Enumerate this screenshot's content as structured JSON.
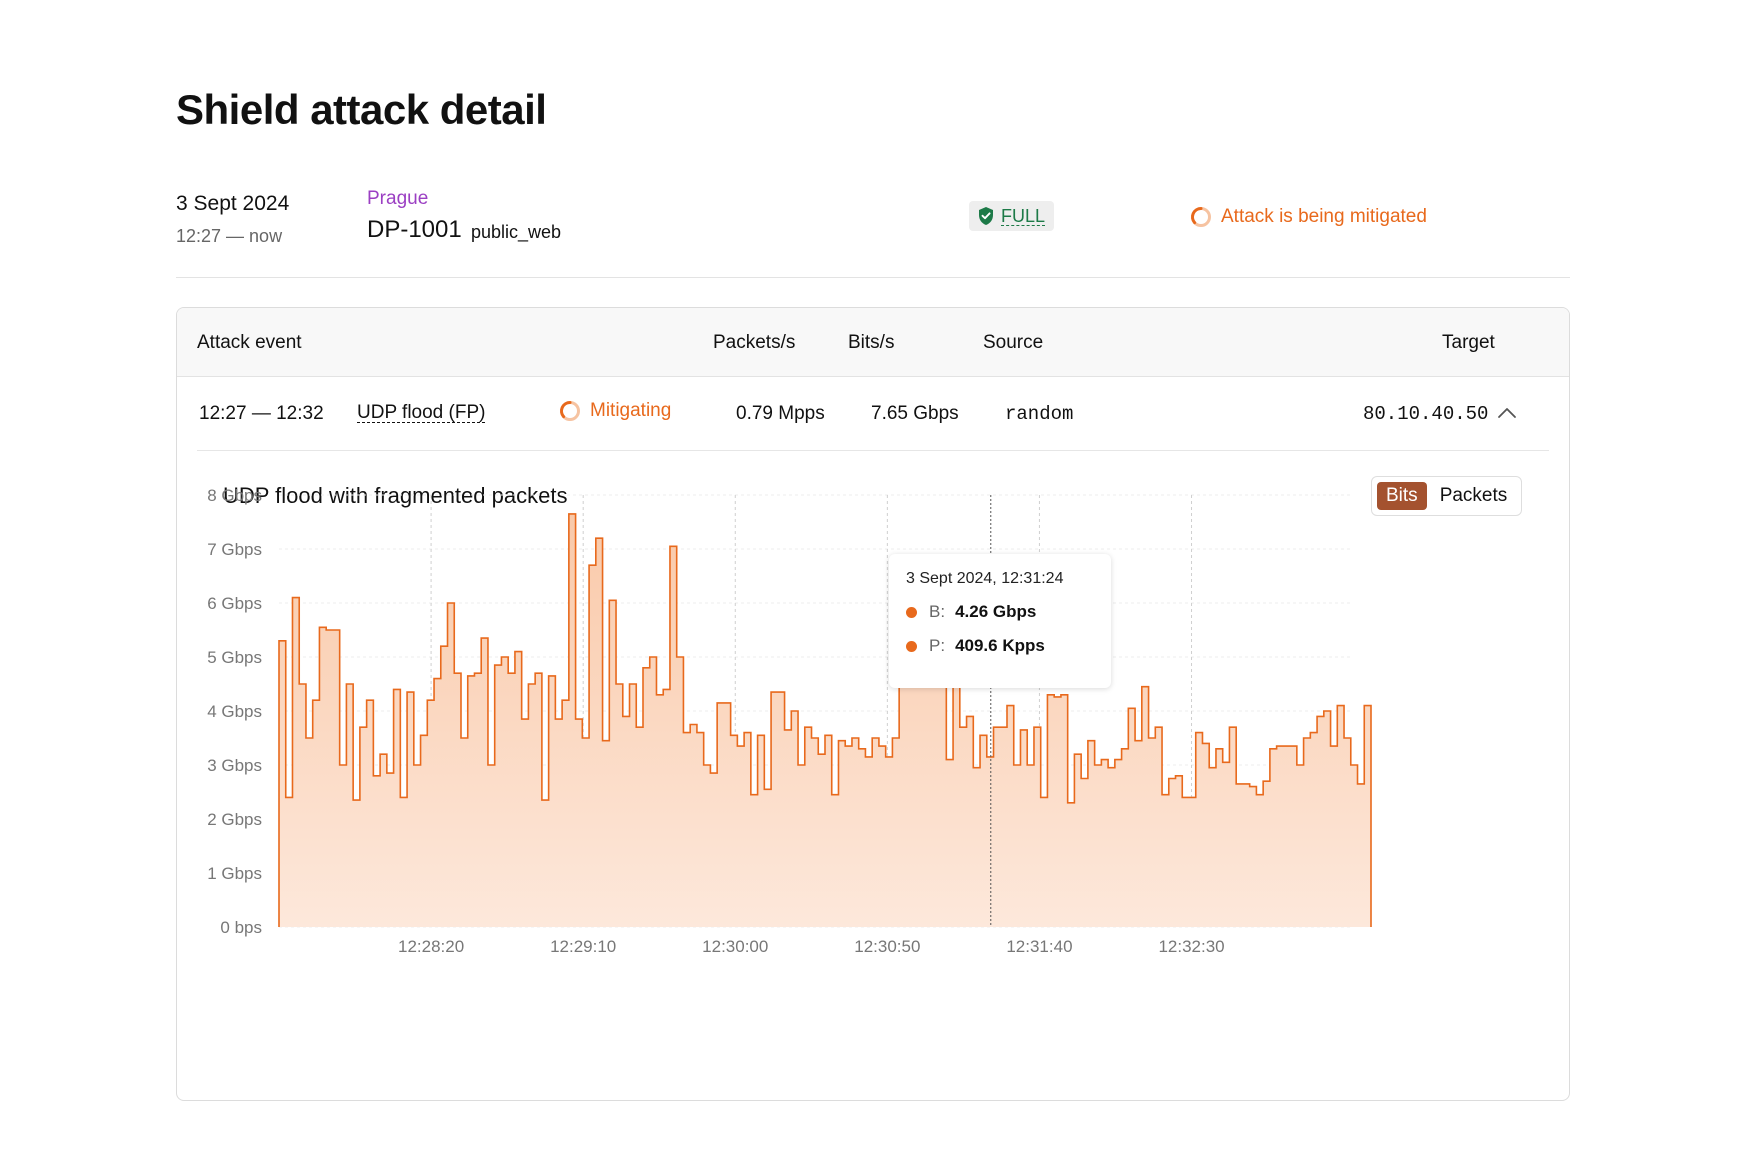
{
  "page": {
    "title": "Shield attack detail"
  },
  "summary": {
    "date": "3 Sept 2024",
    "time_range": "12:27 — now",
    "location": "Prague",
    "policy_id": "DP-1001",
    "policy_name": "public_web",
    "protection_level": "FULL",
    "status": "Attack is being mitigated"
  },
  "colors": {
    "accent": "#e8691c",
    "location": "#9b3fc3",
    "shield": "#1d7a48",
    "toggle_active": "#a4522f"
  },
  "table": {
    "headers": {
      "event": "Attack event",
      "packets": "Packets/s",
      "bits": "Bits/s",
      "source": "Source",
      "target": "Target"
    },
    "row": {
      "time": "12:27 — 12:32",
      "type": "UDP flood (FP)",
      "status": "Mitigating",
      "packets": "0.79 Mpps",
      "bits": "7.65 Gbps",
      "source": "random",
      "target": "80.10.40.50"
    }
  },
  "detail": {
    "title": "UDP flood with fragmented packets",
    "toggle": {
      "bits": "Bits",
      "packets": "Packets",
      "selected": "Bits"
    }
  },
  "tooltip": {
    "time": "3 Sept 2024, 12:31:24",
    "b_label": "B:",
    "b_value": "4.26 Gbps",
    "p_label": "P:",
    "p_value": "409.6 Kpps"
  },
  "chart_data": {
    "type": "area",
    "step": true,
    "ylim": [
      0,
      8
    ],
    "y_ticks": [
      {
        "value": 0,
        "label": "0 bps"
      },
      {
        "value": 1,
        "label": "1 Gbps"
      },
      {
        "value": 2,
        "label": "2 Gbps"
      },
      {
        "value": 3,
        "label": "3 Gbps"
      },
      {
        "value": 4,
        "label": "4 Gbps"
      },
      {
        "value": 5,
        "label": "5 Gbps"
      },
      {
        "value": 6,
        "label": "6 Gbps"
      },
      {
        "value": 7,
        "label": "7 Gbps"
      },
      {
        "value": 8,
        "label": "8 Gbps"
      }
    ],
    "x_start": "12:27:30",
    "x_end": "12:33:29",
    "x_ticks": [
      "12:28:20",
      "12:29:10",
      "12:30:00",
      "12:30:50",
      "12:31:40",
      "12:32:30"
    ],
    "hover_time": "12:31:24",
    "grid": true,
    "series": [
      {
        "values": [
          5.3,
          2.4,
          6.1,
          4.5,
          3.5,
          4.2,
          5.55,
          5.5,
          5.5,
          3.0,
          4.5,
          2.35,
          3.7,
          4.2,
          2.8,
          3.2,
          2.85,
          4.4,
          2.4,
          4.35,
          3.0,
          3.55,
          4.2,
          4.6,
          5.2,
          6.0,
          4.7,
          3.5,
          4.65,
          4.7,
          5.35,
          3.0,
          4.85,
          5.0,
          4.7,
          5.1,
          3.85,
          4.5,
          4.7,
          2.35,
          4.65,
          3.85,
          4.2,
          7.65,
          3.85,
          3.5,
          6.7,
          7.2,
          3.45,
          6.05,
          4.5,
          3.9,
          4.5,
          3.7,
          4.8,
          5.0,
          4.3,
          4.4,
          7.05,
          5.0,
          3.6,
          3.75,
          3.6,
          3.0,
          2.85,
          4.15,
          4.15,
          3.55,
          3.35,
          3.6,
          2.45,
          3.55,
          2.55,
          4.35,
          4.35,
          3.65,
          4.0,
          3.0,
          3.7,
          3.5,
          3.2,
          3.55,
          2.45,
          3.45,
          3.35,
          3.5,
          3.3,
          3.15,
          3.5,
          3.35,
          3.15,
          3.5,
          4.75,
          4.5,
          4.75,
          5.25,
          4.55,
          5.05,
          4.5,
          3.1,
          4.45,
          3.7,
          3.9,
          2.95,
          3.55,
          3.15,
          3.7,
          3.7,
          4.1,
          3.0,
          3.65,
          3.0,
          3.7,
          2.4,
          4.3,
          4.26,
          4.3,
          2.3,
          3.2,
          2.75,
          3.45,
          3.0,
          3.1,
          2.95,
          3.1,
          3.3,
          4.05,
          3.45,
          4.45,
          3.5,
          3.7,
          2.45,
          2.75,
          2.8,
          2.4,
          2.4,
          3.6,
          3.4,
          2.95,
          3.3,
          3.05,
          3.7,
          2.65,
          2.65,
          2.6,
          2.45,
          2.7,
          3.3,
          3.35,
          3.35,
          3.35,
          3.0,
          3.5,
          3.6,
          3.9,
          4.0,
          3.35,
          4.1,
          3.5,
          3.0,
          2.65,
          4.1
        ]
      }
    ]
  }
}
